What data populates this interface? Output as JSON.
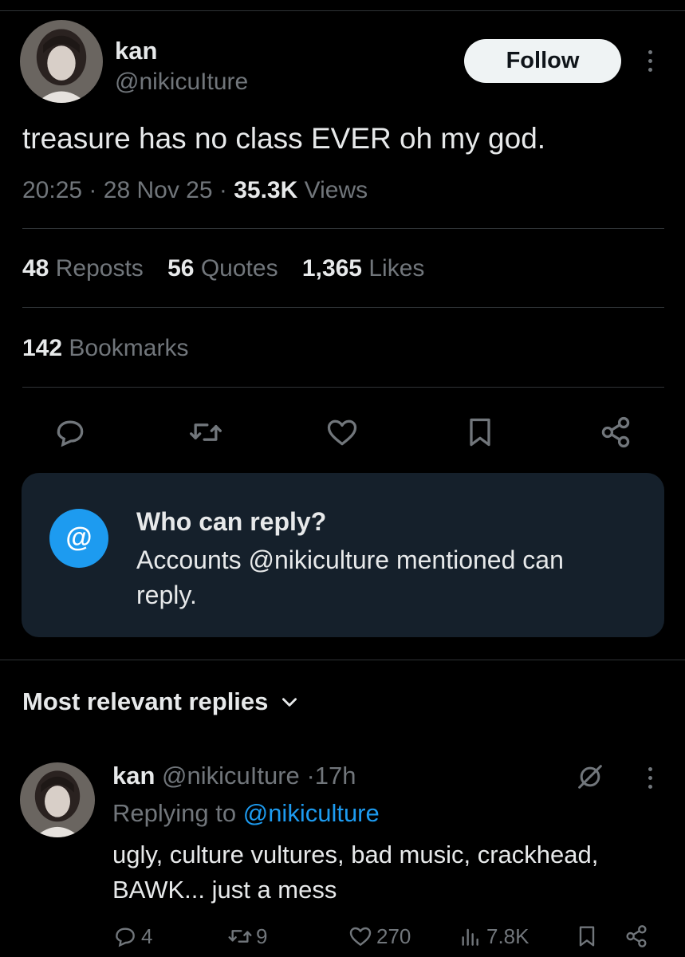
{
  "author": {
    "name": "kan",
    "handle": "@nikicuIture",
    "follow_label": "Follow"
  },
  "tweet": {
    "text": "treasure has no class EVER oh my god.",
    "time": "20:25",
    "date": "28 Nov 25",
    "views_count": "35.3K",
    "views_label": "Views",
    "sep": "·"
  },
  "stats": {
    "reposts_count": "48",
    "reposts_label": "Reposts",
    "quotes_count": "56",
    "quotes_label": "Quotes",
    "likes_count": "1,365",
    "likes_label": "Likes",
    "bookmarks_count": "142",
    "bookmarks_label": "Bookmarks"
  },
  "actions": [
    "reply-icon",
    "repost-icon",
    "like-icon",
    "bookmark-icon",
    "share-icon"
  ],
  "who_can_reply": {
    "icon": "@",
    "title": "Who can reply?",
    "description": "Accounts @nikiculture mentioned can reply."
  },
  "replies_section": {
    "sort_label": "Most relevant replies"
  },
  "reply": {
    "name": "kan",
    "handle": "@nikicuIture",
    "sep": "·",
    "age": "17h",
    "replying_prefix": "Replying to",
    "replying_to": "@nikiculture",
    "text": "ugly, culture vultures, bad music, crackhead, BAWK... just a mess",
    "replies": "4",
    "reposts": "9",
    "likes": "270",
    "views": "7.8K"
  },
  "colors": {
    "background": "#000000",
    "text": "#e7e9ea",
    "secondary": "#71767b",
    "accent": "#1d9bf0",
    "reply_box": "#15202b"
  }
}
